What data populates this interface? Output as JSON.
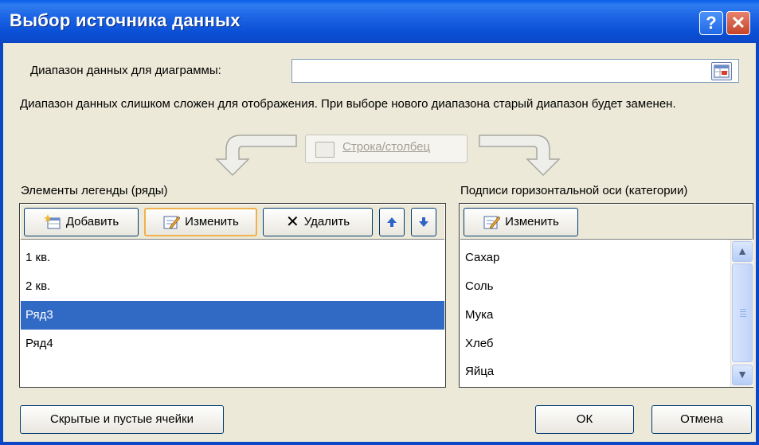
{
  "dialog": {
    "title": "Выбор источника данных"
  },
  "range": {
    "label": "Диапазон данных для диаграммы:",
    "value": ""
  },
  "message": "Диапазон данных слишком сложен для отображения. При выборе нового диапазона старый диапазон будет заменен.",
  "switch_button": {
    "label": "Строка/столбец"
  },
  "legend": {
    "label": "Элементы легенды (ряды)",
    "add_label": "Добавить",
    "edit_label": "Изменить",
    "delete_label": "Удалить",
    "items": [
      "1 кв.",
      "2 кв.",
      "Ряд3",
      "Ряд4"
    ],
    "selected": "Ряд3"
  },
  "axis": {
    "label": "Подписи горизонтальной оси (категории)",
    "edit_label": "Изменить",
    "items": [
      "Сахар",
      "Соль",
      "Мука",
      "Хлеб",
      "Яйца"
    ]
  },
  "footer": {
    "hidden_cells_label": "Скрытые и пустые ячейки",
    "ok_label": "ОК",
    "cancel_label": "Отмена"
  },
  "colors": {
    "titlebar": "#0a50d6",
    "selection": "#316ac5",
    "window_bg": "#ece9d8"
  }
}
